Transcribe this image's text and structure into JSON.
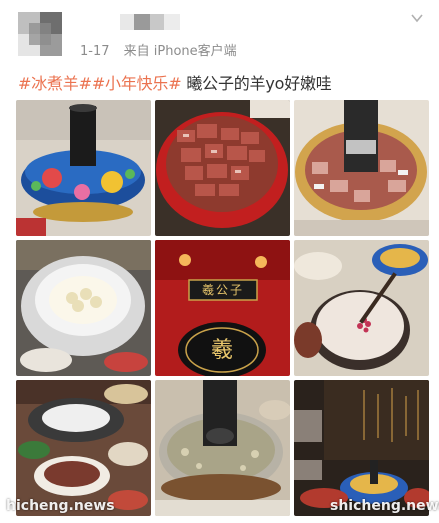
{
  "post": {
    "date": "1-17",
    "source": "来自 iPhone客户端",
    "tags": [
      "#冰煮羊#",
      "#小年快乐#"
    ],
    "body": " 曦公子的羊yo好嫩哇"
  },
  "photos": [
    {
      "name": "copper-hotpot-photo"
    },
    {
      "name": "raw-lamb-pot-photo"
    },
    {
      "name": "lamb-hotpot-photo"
    },
    {
      "name": "ice-plate-photo"
    },
    {
      "name": "restaurant-sign-photo"
    },
    {
      "name": "milk-soup-photo"
    },
    {
      "name": "table-spread-photo"
    },
    {
      "name": "boiling-pot-photo"
    },
    {
      "name": "restaurant-interior-photo"
    }
  ],
  "signage": {
    "restaurant_name": "羲公子",
    "logo_char": "羲"
  },
  "watermark": {
    "left": "hicheng.news",
    "right": "shicheng.news"
  },
  "colors": {
    "tag": "#eb7350",
    "meta": "#8c8c8c"
  }
}
